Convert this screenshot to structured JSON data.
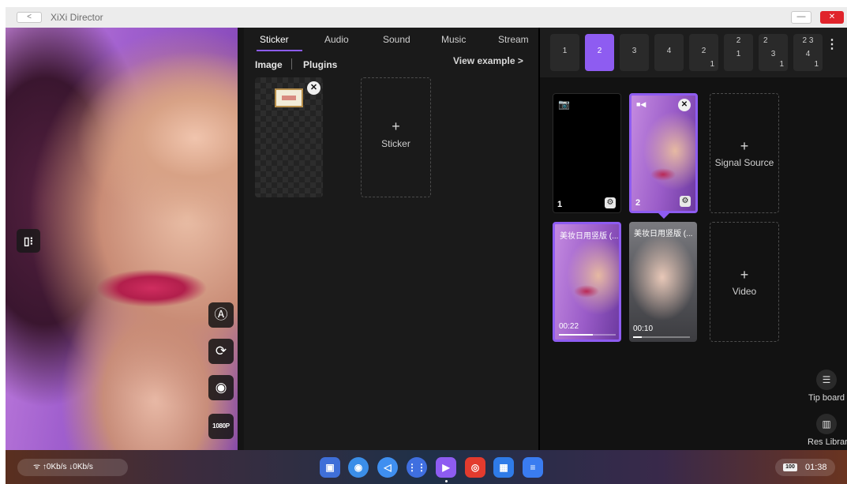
{
  "window": {
    "title": "XiXi Director",
    "back_glyph": "<",
    "minimize_glyph": "—",
    "close_glyph": "✕"
  },
  "preview": {
    "toggle_glyph": "▯⁝",
    "buttons": [
      {
        "icon": "beauty-icon",
        "glyph": "Ⓐ"
      },
      {
        "icon": "camera-flip-icon",
        "glyph": "⟳"
      },
      {
        "icon": "record-icon",
        "glyph": "◉"
      },
      {
        "icon": "resolution-icon",
        "glyph": "1080P"
      }
    ]
  },
  "middle": {
    "tabs": [
      "Sticker",
      "Audio",
      "Sound",
      "Music",
      "Stream"
    ],
    "active_tab": "Sticker",
    "subtabs": [
      "Image",
      "Plugins"
    ],
    "view_example": "View example  >",
    "add_plus": "+",
    "add_label": "Sticker",
    "remove_glyph": "✕"
  },
  "right": {
    "scenes": [
      {
        "top": "",
        "main": "1",
        "corner": ""
      },
      {
        "top": "",
        "main": "2",
        "corner": ""
      },
      {
        "top": "",
        "main": "3",
        "corner": ""
      },
      {
        "top": "",
        "main": "4",
        "corner": ""
      },
      {
        "top": "",
        "main": "2",
        "corner": "1"
      },
      {
        "top": "2",
        "main": "1",
        "corner": ""
      },
      {
        "top": "2",
        "main": "3",
        "corner": "1"
      },
      {
        "top": "2  3",
        "main": "4",
        "corner": "1"
      }
    ],
    "active_scene": 2,
    "more_glyph": "⋮",
    "sources": [
      {
        "icon": "camera-icon",
        "glyph": "📷",
        "number": "1",
        "gear": "⚙"
      },
      {
        "icon": "video-camera-icon",
        "glyph": "■◀",
        "number": "2",
        "gear": "⚙",
        "close": "✕"
      }
    ],
    "add_signal_label": "Signal Source",
    "videos": [
      {
        "title": "美妆日用竖版 (...",
        "duration": "00:22",
        "progress": 0.6
      },
      {
        "title": "美妆日用竖版 (...",
        "duration": "00:10",
        "progress": 0.15
      }
    ],
    "add_video_label": "Video",
    "plus": "+",
    "tip_board_label": "Tip board",
    "tip_board_glyph": "☰",
    "res_library_label": "Res Library",
    "res_library_glyph": "▥"
  },
  "taskbar": {
    "network": "↑0Kb/s ↓0Kb/s",
    "network_glyph": "ᯤ",
    "battery": "100",
    "time": "01:38",
    "dock": [
      {
        "name": "screen-capture-icon",
        "glyph": "▣",
        "color": "#3f6fd8"
      },
      {
        "name": "assistive-icon",
        "glyph": "◉",
        "color": "#3b8ee8"
      },
      {
        "name": "back-nav-icon",
        "glyph": "◁",
        "color": "#3f8ff0"
      },
      {
        "name": "app-grid-icon",
        "glyph": "⋮⋮",
        "color": "#3f6fe0"
      },
      {
        "name": "director-app-icon",
        "glyph": "▶",
        "color": "#8e5cf1"
      },
      {
        "name": "chrome-icon",
        "glyph": "◎",
        "color": "#e33b2e"
      },
      {
        "name": "calculator-icon",
        "glyph": "▦",
        "color": "#2f7be8"
      },
      {
        "name": "notes-icon",
        "glyph": "≡",
        "color": "#3a7cf0"
      }
    ]
  },
  "colors": {
    "accent": "#8e5cf1",
    "close_red": "#e0242b"
  }
}
